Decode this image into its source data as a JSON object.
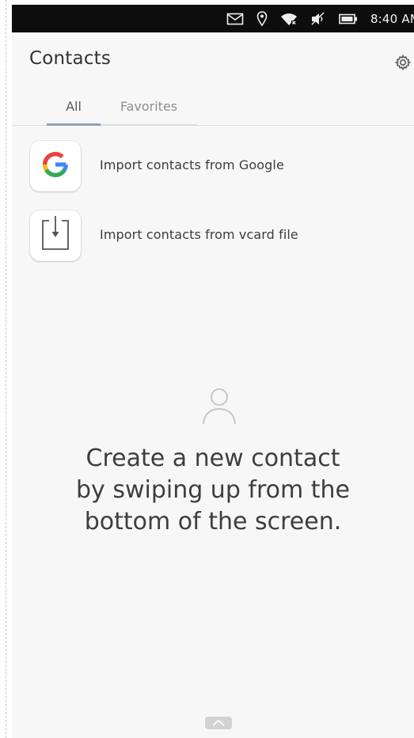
{
  "status_bar": {
    "time": "8:40 AM",
    "icons": [
      "mail-icon",
      "location-icon",
      "wifi-icon",
      "volume-muted-icon",
      "battery-icon"
    ]
  },
  "header": {
    "title": "Contacts",
    "settings_icon": "gear-icon",
    "tabs": [
      {
        "label": "All",
        "active": true
      },
      {
        "label": "Favorites",
        "active": false
      }
    ]
  },
  "list": {
    "items": [
      {
        "label": "Import contacts from Google",
        "icon": "google-logo-icon"
      },
      {
        "label": "Import contacts from vcard file",
        "icon": "download-file-icon"
      }
    ]
  },
  "empty_state": {
    "icon": "person-icon",
    "message": "Create a new contact\nby swiping up from the\nbottom of the screen."
  },
  "bottom_handle": {
    "icon": "chevron-up-icon"
  },
  "colors": {
    "status_bar_bg": "#0d0d0d",
    "background": "#f7f7f7",
    "active_tab_indicator": "#8ea3b8",
    "text_primary": "#333333"
  }
}
